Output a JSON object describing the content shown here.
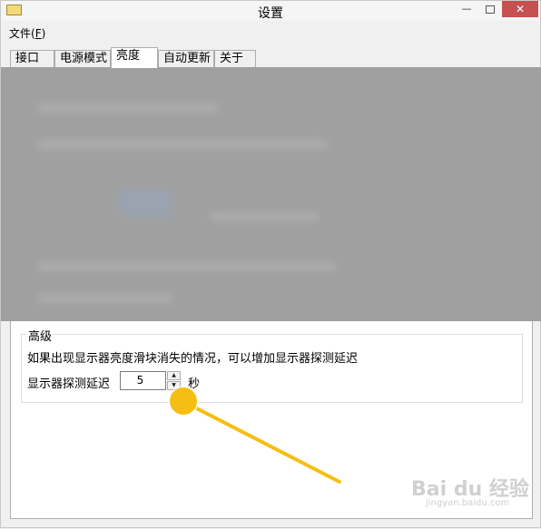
{
  "window": {
    "title": "设置",
    "minimize": "—",
    "close": "✕"
  },
  "menu": {
    "file_label": "文件(",
    "file_accel": "F",
    "file_close": ")"
  },
  "tabs": [
    {
      "label": "接口"
    },
    {
      "label": "电源模式"
    },
    {
      "label": "亮度"
    },
    {
      "label": "自动更新"
    },
    {
      "label": "关于"
    }
  ],
  "advanced": {
    "title": "高级",
    "hint": "如果出现显示器亮度滑块消失的情况，可以增加显示器探测延迟",
    "delay_label": "显示器探测延迟",
    "delay_value": "5",
    "unit": "秒"
  },
  "colors": {
    "callout": "#f5be12",
    "blur_overlay": "#a0a0a0"
  },
  "watermark": {
    "text": "Bai du 经验",
    "sub": "jingyan.baidu.com"
  }
}
